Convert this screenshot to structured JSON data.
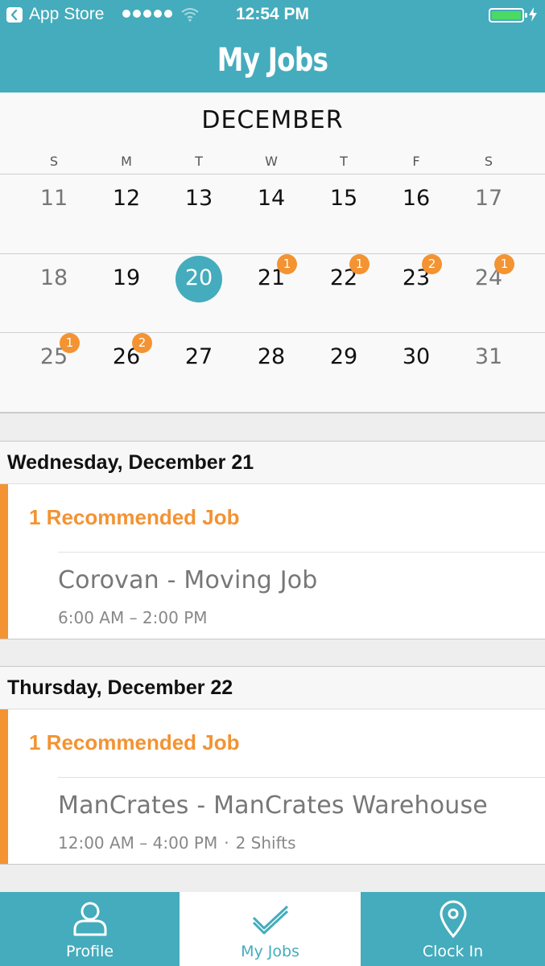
{
  "status_bar": {
    "back_app": "App Store",
    "time": "12:54 PM"
  },
  "header": {
    "title": "My Jobs"
  },
  "calendar": {
    "month": "DECEMBER",
    "weekdays": [
      "S",
      "M",
      "T",
      "W",
      "T",
      "F",
      "S"
    ],
    "weeks": [
      [
        "11",
        "12",
        "13",
        "14",
        "15",
        "16",
        "17"
      ],
      [
        "18",
        "19",
        "20",
        "21",
        "22",
        "23",
        "24"
      ],
      [
        "25",
        "26",
        "27",
        "28",
        "29",
        "30",
        "31"
      ]
    ],
    "selected_day": "20",
    "badges": {
      "21": "1",
      "22": "1",
      "23": "2",
      "24": "1",
      "25": "1",
      "26": "2"
    },
    "colors": {
      "selected": "#44acbc",
      "badge": "#f39332"
    }
  },
  "days": [
    {
      "date": "Wednesday, December 21",
      "recommended": "1 Recommended Job",
      "job": "Corovan - Moving Job",
      "time": "6:00 AM – 2:00 PM",
      "shifts": ""
    },
    {
      "date": "Thursday, December 22",
      "recommended": "1 Recommended Job",
      "job": "ManCrates - ManCrates Warehouse",
      "time": "12:00 AM – 4:00 PM",
      "separator": "·",
      "shifts": "2 Shifts"
    }
  ],
  "tabs": [
    {
      "label": "Profile",
      "icon": "profile-icon",
      "active": false
    },
    {
      "label": "My Jobs",
      "icon": "checkmark-icon",
      "active": true
    },
    {
      "label": "Clock In",
      "icon": "location-pin-icon",
      "active": false
    }
  ],
  "theme": {
    "primary": "#44acbc",
    "accent": "#f39332"
  }
}
